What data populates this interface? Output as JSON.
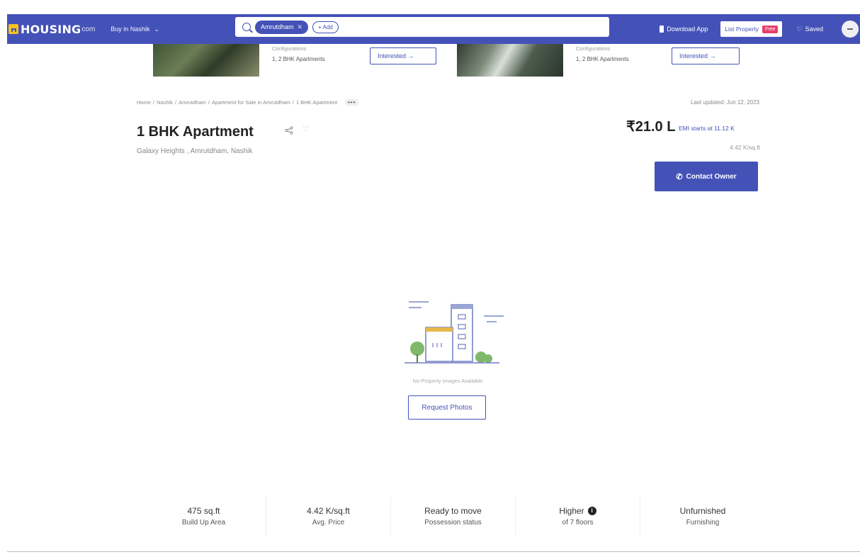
{
  "nav": {
    "logo_text": "HOUSING",
    "logo_suffix": "com",
    "city_selector": "Buy in Nashik",
    "search_chip": "Amrutdham",
    "search_add": "+ Add",
    "download_app": "Download App",
    "list_property": "List Property",
    "free_badge": "Free",
    "saved": "Saved"
  },
  "similar": [
    {
      "label": "Configurations",
      "config": "1, 2 BHK Apartments",
      "cta": "Interested →"
    },
    {
      "label": "Configurations",
      "config": "1, 2 BHK Apartments",
      "cta": "Interested →"
    }
  ],
  "breadcrumb": {
    "items": [
      "Home",
      "Nashik",
      "Amrutdham",
      "Apartment for Sale in Amrutdham",
      "1 BHK Apartment"
    ],
    "separator": "/",
    "more": "•••"
  },
  "last_updated": "Last updated: Jun 12, 2023",
  "listing": {
    "title": "1 BHK Apartment",
    "location": "Galaxy Heights , Amrutdham, Nashik",
    "price": "₹21.0 L",
    "emi": "EMI starts at 11.12 K",
    "price_per_sqft": "4.42 K/sq.ft",
    "contact_cta": "Contact Owner"
  },
  "gallery": {
    "empty_text": "No Property Images Available",
    "request_cta": "Request Photos"
  },
  "facts": [
    {
      "value": "475 sq.ft",
      "label": "Build Up Area"
    },
    {
      "value": "4.42 K/sq.ft",
      "label": "Avg. Price"
    },
    {
      "value": "Ready to move",
      "label": "Possession status"
    },
    {
      "value": "Higher",
      "label": "of 7 floors"
    },
    {
      "value": "Unfurnished",
      "label": "Furnishing"
    }
  ],
  "colors": {
    "brand": "#4452b8",
    "accent_yellow": "#f7c31e",
    "free_badge": "#e93f6b"
  }
}
